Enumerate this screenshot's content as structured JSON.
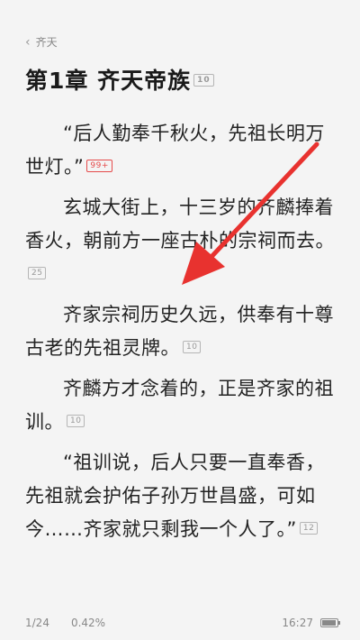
{
  "header": {
    "back_glyph": "‹",
    "book_title": "齐天",
    "chapter_title": "第1章 齐天帝族",
    "chapter_comment_count": "10"
  },
  "paragraphs": [
    {
      "text": "“后人勤奉千秋火，先祖长明万世灯。”",
      "comments": "99+",
      "hot": true
    },
    {
      "text": "玄城大街上，十三岁的齐麟捧着香火，朝前方一座古朴的宗祠而去。",
      "comments": "25",
      "hot": false
    },
    {
      "text": "齐家宗祠历史久远，供奉有十尊古老的先祖灵牌。",
      "comments": "10",
      "hot": false
    },
    {
      "text": "齐麟方才念着的，正是齐家的祖训。",
      "comments": "10",
      "hot": false
    },
    {
      "text": "“祖训说，后人只要一直奉香，先祖就会护佑子孙万世昌盛，可如今……齐家就只剩我一个人了。”",
      "comments": "12",
      "hot": false
    }
  ],
  "footer": {
    "page": "1/24",
    "progress": "0.42%",
    "time": "16:27",
    "battery_icon": "battery-icon"
  },
  "overlay": {
    "arrow_color": "#e8322f",
    "arrow_icon": "arrow-pointer-icon"
  }
}
